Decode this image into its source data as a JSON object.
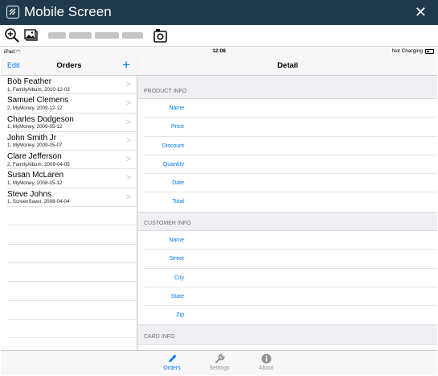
{
  "window": {
    "title": "Mobile Screen",
    "close_glyph": "✕"
  },
  "toolbar": {
    "zoom_icon": "zoom-in-icon",
    "image_icon": "image-icon",
    "screenshot_icon": "camera-icon"
  },
  "status_bar": {
    "device": "iPad",
    "time": "12:08",
    "charging": "Not Charging"
  },
  "master": {
    "edit_label": "Edit",
    "title": "Orders",
    "add_label": "+",
    "orders": [
      {
        "name": "Bob Feather",
        "detail": "1, FamilyAlbum, 2010-12-03"
      },
      {
        "name": "Samuel Clemens",
        "detail": "2, MyMoney, 2009-12-12"
      },
      {
        "name": "Charles Dodgeson",
        "detail": "1, MyMoney, 2009-05-12"
      },
      {
        "name": "John Smith Jr",
        "detail": "1, MyMoney, 2009-05-07"
      },
      {
        "name": "Clare Jefferson",
        "detail": "2, FamilyAlbum, 2009-04-05"
      },
      {
        "name": "Susan McLaren",
        "detail": "1, MyMoney, 2008-05-12"
      },
      {
        "name": "Steve Johns",
        "detail": "1, ScreenSaver, 2008-04-04"
      }
    ]
  },
  "detail": {
    "title": "Detail",
    "sections": [
      {
        "header": "PRODUCT INFO",
        "fields": [
          "Name",
          "Price",
          "Discount",
          "Quantity",
          "Date",
          "Total"
        ]
      },
      {
        "header": "CUSTOMER INFO",
        "fields": [
          "Name",
          "Street",
          "City",
          "State",
          "Zip"
        ]
      },
      {
        "header": "CARD INFO",
        "fields": []
      }
    ]
  },
  "tabs": [
    {
      "label": "Orders",
      "icon": "pencil-icon",
      "active": true
    },
    {
      "label": "Settings",
      "icon": "wrench-icon",
      "active": false
    },
    {
      "label": "About",
      "icon": "info-icon",
      "active": false
    }
  ],
  "colors": {
    "titlebar": "#1e3a4c",
    "accent": "#007aff",
    "inactive_tab": "#929292"
  }
}
